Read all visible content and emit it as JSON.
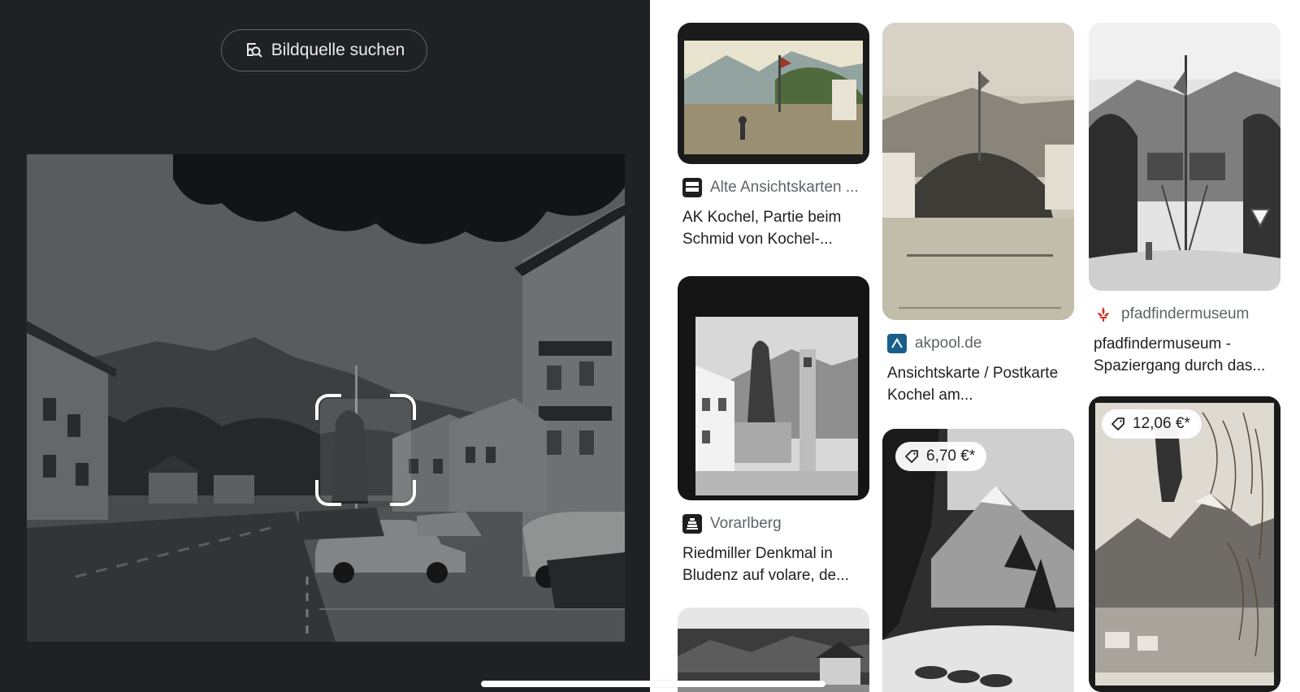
{
  "search_source": {
    "label": "Bildquelle suchen",
    "icon": "image-search-icon"
  },
  "results": [
    {
      "source": "Alte Ansichtskarten ...",
      "title": "AK Kochel, Partie beim Schmid von Kochel-...",
      "icon": "postcard-shop-logo",
      "price": ""
    },
    {
      "source": "akpool.de",
      "title": "Ansichtskarte / Postkarte Kochel am...",
      "icon": "akpool-logo",
      "price": ""
    },
    {
      "source": "pfadfindermuseum",
      "title": "pfadfindermuseum - Spaziergang durch das...",
      "icon": "fleur-de-lis-logo",
      "price": ""
    },
    {
      "source": "Vorarlberg",
      "title": "Riedmiller Denkmal in Bludenz auf volare, de...",
      "icon": "vorarlberg-logo",
      "price": ""
    },
    {
      "source": "",
      "title": "",
      "icon": "",
      "price": "6,70 €*"
    },
    {
      "source": "",
      "title": "",
      "icon": "",
      "price": "12,06 €*"
    }
  ],
  "colors": {
    "dark_bg": "#202124",
    "text_primary": "#202124",
    "text_secondary": "#5f6368",
    "pfadfinder_red": "#d93025",
    "akpool_blue": "#1a5f8a"
  }
}
